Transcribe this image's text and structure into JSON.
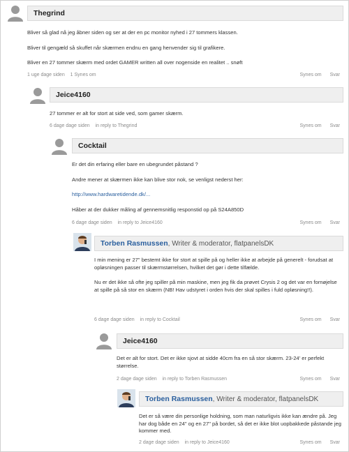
{
  "comments": [
    {
      "author": "Thegrind",
      "role": "",
      "paragraphs": [
        "Bliver så glad nå jeg åbner siden og ser at der en pc monitor nyhed i 27 tommers klassen.",
        "Bliver til gengæld så skuffet når skærmen endnu en gang henvender sig til grafikere.",
        "Bliver en 27 tommer skærm med ordet GAMER written all over nogenside en realitet .. snøft"
      ],
      "time": "1 uge dage siden",
      "reply_info": "1 Synes om",
      "like_label": "Synes om",
      "reply_label": "Svar"
    },
    {
      "author": "Jeice4160",
      "role": "",
      "paragraphs": [
        "27 tommer er alt for stort at side ved, som gamer skærm."
      ],
      "time": "6 dage dage siden",
      "reply_info": "in reply to Thegrind",
      "like_label": "Synes om",
      "reply_label": "Svar"
    },
    {
      "author": "Cocktail",
      "role": "",
      "paragraphs": [
        "Er det din erfaring eller bare en ubegrundet påstand ?",
        "Andre mener at skærmen ikke kan blive stor nok, se venligst nederst her:",
        "http://www.hardwaretidende.dk/...",
        "Håber at der dukker måling af gennemsnitlig responstid op på S24A850D"
      ],
      "time": "6 dage dage siden",
      "reply_info": "in reply to Jeice4160",
      "like_label": "Synes om",
      "reply_label": "Svar"
    },
    {
      "author": "Torben Rasmussen",
      "role": ", Writer & moderator, flatpanelsDK",
      "paragraphs": [
        "I min mening er 27\" bestemt ikke for stort at spille på og heller ikke at arbejde på generelt - forudsat at opløsningen passer til skærmstørrelsen, hvilket det gør i dette tilfælde.",
        "Nu er det ikke så ofte jeg spiller på min maskine, men jeg fik da prøvet Crysis 2 og det var en fornøjelse at spille på så stor en skærm (NB! Hav udstyret i orden hvis der skal spilles i fuld opløsning!!)."
      ],
      "time": "6 dage dage siden",
      "reply_info": "in reply to Cocktail",
      "like_label": "Synes om",
      "reply_label": "Svar"
    },
    {
      "author": "Jeice4160",
      "role": "",
      "paragraphs": [
        "Det er alt for stort. Det er ikke sjovt at sidde 40cm fra en så stor skærm. 23-24' er perfekt størrelse."
      ],
      "time": "2 dage dage siden",
      "reply_info": "in reply to Torben Rasmussen",
      "like_label": "Synes om",
      "reply_label": "Svar"
    },
    {
      "author": "Torben Rasmussen",
      "role": ", Writer & moderator, flatpanelsDK",
      "paragraphs": [
        "Det er så være din personlige holdning, som man naturligvis ikke kan ændre på. Jeg har dog både en 24\" og en 27\" på bordet, så det er ikke blot uopbakkede påstande jeg kommer med."
      ],
      "time": "2 dage dage siden",
      "reply_info": "in reply to Jeice4160",
      "like_label": "Synes om",
      "reply_label": "Svar"
    }
  ]
}
